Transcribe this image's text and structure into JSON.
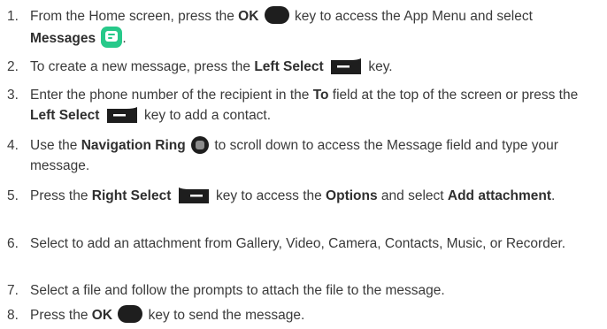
{
  "steps": [
    {
      "num": "1.",
      "parts": [
        "From the Home screen, press the ",
        "OK",
        " key to access the App Menu and select ",
        "Messages",
        "."
      ]
    },
    {
      "num": "2.",
      "parts": [
        "To create a new message, press the ",
        "Left Select",
        " key."
      ]
    },
    {
      "num": "3.",
      "parts": [
        "Enter the phone number of the recipient in the ",
        "To",
        " field at the top of the screen or press the ",
        "Left Select",
        " key to add a contact."
      ]
    },
    {
      "num": "4.",
      "parts": [
        "Use the ",
        "Navigation Ring",
        " to scroll down to access the Message field and type your message."
      ]
    },
    {
      "num": "5.",
      "parts": [
        "Press the ",
        "Right Select",
        " key to access the ",
        "Options",
        " and select ",
        "Add attachment",
        "."
      ]
    },
    {
      "num": "6.",
      "parts": [
        "Select to add an attachment from Gallery, Video, Camera, Contacts, Music, or Recorder."
      ]
    },
    {
      "num": "7.",
      "parts": [
        "Select a file and follow the prompts to attach the file to the message."
      ]
    },
    {
      "num": "8.",
      "parts": [
        "Press the ",
        "OK",
        " key to send the message."
      ]
    }
  ],
  "icons": {
    "ok_key": "ok-key-icon",
    "messages_app": "messages-app-icon",
    "left_select": "left-select-key-icon",
    "right_select": "right-select-key-icon",
    "navigation_ring": "navigation-ring-icon"
  },
  "colors": {
    "text": "#3a3a3a",
    "key": "#1e1e1e",
    "messages_icon": "#27c98a",
    "ring_center": "#8c8c8c"
  }
}
